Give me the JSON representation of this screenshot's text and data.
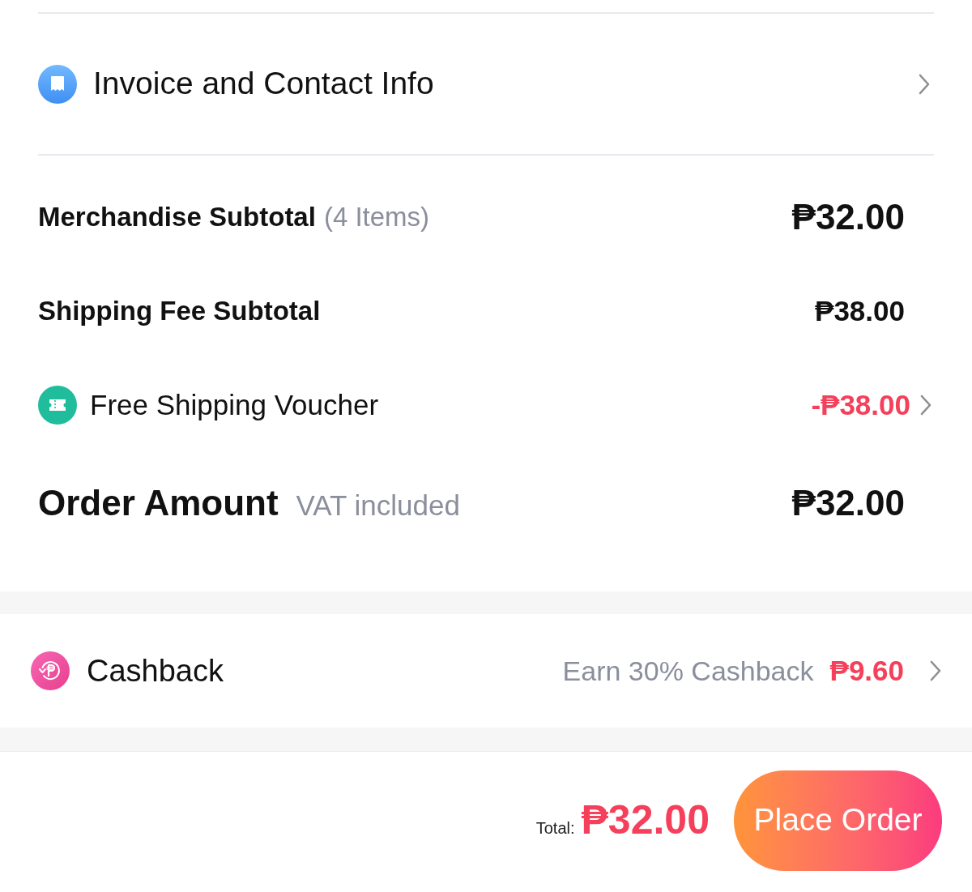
{
  "invoice_row": {
    "label": "Invoice and Contact Info"
  },
  "merchandise_subtotal": {
    "label": "Merchandise Subtotal",
    "note": "(4 Items)",
    "amount": "₱32.00"
  },
  "shipping_fee_subtotal": {
    "label": "Shipping Fee Subtotal",
    "amount": "₱38.00"
  },
  "voucher": {
    "label": "Free Shipping Voucher",
    "amount": "-₱38.00"
  },
  "order_amount": {
    "label": "Order Amount",
    "note": "VAT included",
    "amount": "₱32.00"
  },
  "cashback": {
    "label": "Cashback",
    "offer": "Earn 30% Cashback",
    "amount": "₱9.60"
  },
  "footer": {
    "total_label": "Total:",
    "total": "₱32.00",
    "button": "Place Order"
  }
}
